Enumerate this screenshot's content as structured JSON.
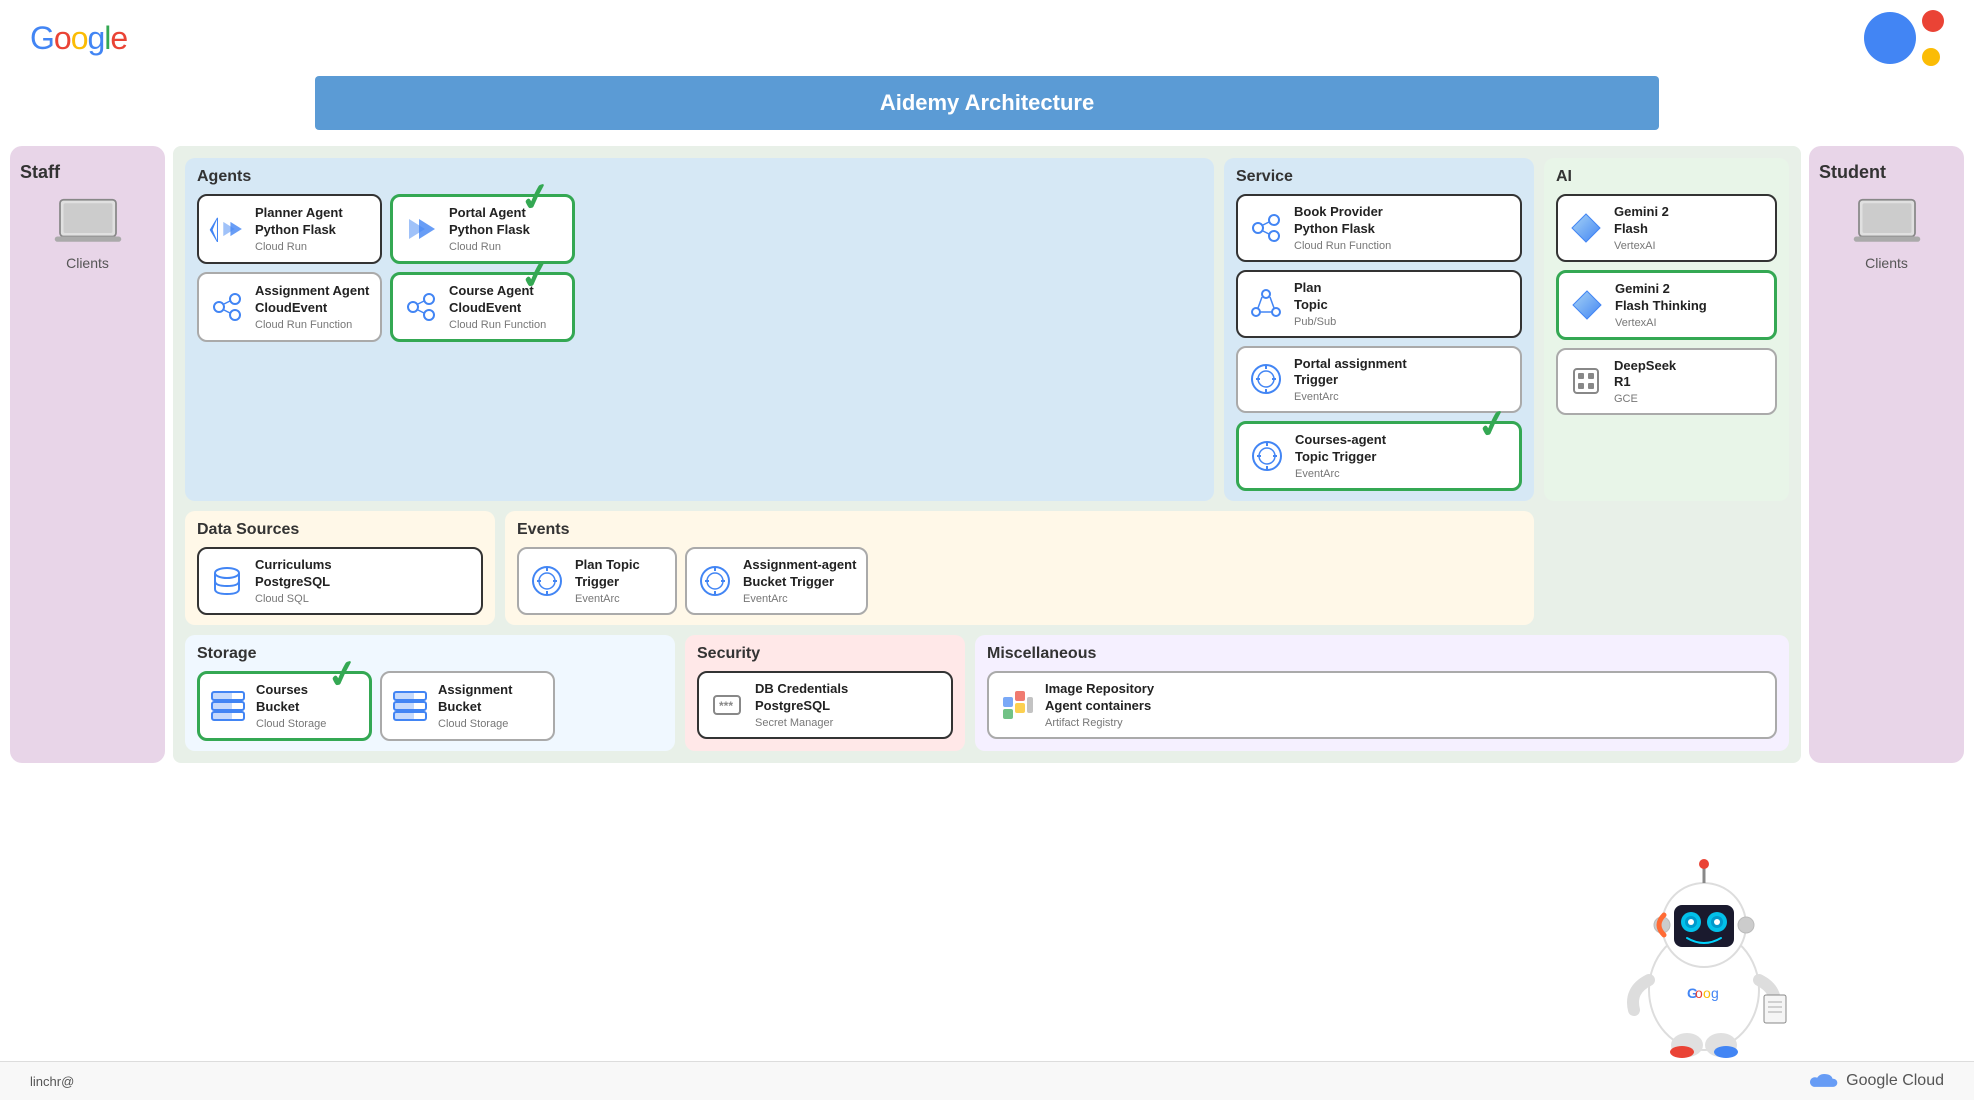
{
  "header": {
    "logo": "Google",
    "title": "Aidemy Architecture",
    "bottom_user": "linchr@",
    "google_cloud_label": "Google Cloud"
  },
  "staff_panel": {
    "label": "Staff",
    "clients_label": "Clients"
  },
  "student_panel": {
    "label": "Student",
    "clients_label": "Clients"
  },
  "sections": {
    "agents": {
      "title": "Agents",
      "cards": [
        {
          "title": "Planner Agent\nPython Flask",
          "subtitle": "Cloud Run",
          "border": "dark",
          "has_checkmark": false,
          "icon": "arrow-double"
        },
        {
          "title": "Portal Agent\nPython Flask",
          "subtitle": "Cloud Run",
          "border": "green",
          "has_checkmark": true,
          "icon": "arrow-double"
        },
        {
          "title": "Assignment Agent\nCloudEvent",
          "subtitle": "Cloud Run Function",
          "border": "normal",
          "has_checkmark": false,
          "icon": "cloud-func"
        },
        {
          "title": "Course Agent\nCloudEvent",
          "subtitle": "Cloud Run Function",
          "border": "green",
          "has_checkmark": true,
          "icon": "cloud-func"
        }
      ]
    },
    "service": {
      "title": "Service",
      "cards": [
        {
          "title": "Book Provider\nPython Flask",
          "subtitle": "Cloud Run Function",
          "border": "dark",
          "has_checkmark": false,
          "icon": "cloud-func"
        },
        {
          "title": "Plan\nTopic",
          "subtitle": "Pub/Sub",
          "border": "dark",
          "has_checkmark": false,
          "icon": "pubsub"
        },
        {
          "title": "Portal assignment\nTrigger",
          "subtitle": "EventArc",
          "border": "normal",
          "has_checkmark": false,
          "icon": "eventarc"
        },
        {
          "title": "Courses-agent\nTopic Trigger",
          "subtitle": "EventArc",
          "border": "green",
          "has_checkmark": true,
          "icon": "eventarc"
        }
      ]
    },
    "ai": {
      "title": "AI",
      "cards": [
        {
          "title": "Gemini 2\nFlash",
          "subtitle": "VertexAI",
          "border": "dark",
          "has_checkmark": false,
          "icon": "diamond"
        },
        {
          "title": "Gemini 2\nFlash Thinking",
          "subtitle": "VertexAI",
          "border": "green",
          "has_checkmark": false,
          "icon": "diamond"
        },
        {
          "title": "DeepSeek\nR1",
          "subtitle": "GCE",
          "border": "normal",
          "has_checkmark": false,
          "icon": "cpu"
        }
      ]
    },
    "datasources": {
      "title": "Data Sources",
      "cards": [
        {
          "title": "Curriculums\nPostgreSQL",
          "subtitle": "Cloud SQL",
          "border": "dark",
          "has_checkmark": false,
          "icon": "database"
        }
      ]
    },
    "events": {
      "title": "Events",
      "cards": [
        {
          "title": "Plan Topic\nTrigger",
          "subtitle": "EventArc",
          "border": "normal",
          "has_checkmark": false,
          "icon": "eventarc"
        },
        {
          "title": "Assignment-agent\nBucket Trigger",
          "subtitle": "EventArc",
          "border": "normal",
          "has_checkmark": false,
          "icon": "eventarc"
        }
      ]
    },
    "storage": {
      "title": "Storage",
      "cards": [
        {
          "title": "Courses\nBucket",
          "subtitle": "Cloud Storage",
          "border": "green",
          "has_checkmark": true,
          "icon": "storage"
        },
        {
          "title": "Assignment\nBucket",
          "subtitle": "Cloud Storage",
          "border": "normal",
          "has_checkmark": false,
          "icon": "storage"
        }
      ]
    },
    "security": {
      "title": "Security",
      "cards": [
        {
          "title": "DB Credentials\nPostgreSQL",
          "subtitle": "Secret Manager",
          "border": "dark",
          "has_checkmark": false,
          "icon": "key"
        }
      ]
    },
    "misc": {
      "title": "Miscellaneous",
      "cards": [
        {
          "title": "Image Repository\nAgent containers",
          "subtitle": "Artifact Registry",
          "border": "normal",
          "has_checkmark": false,
          "icon": "artifact"
        }
      ]
    }
  }
}
